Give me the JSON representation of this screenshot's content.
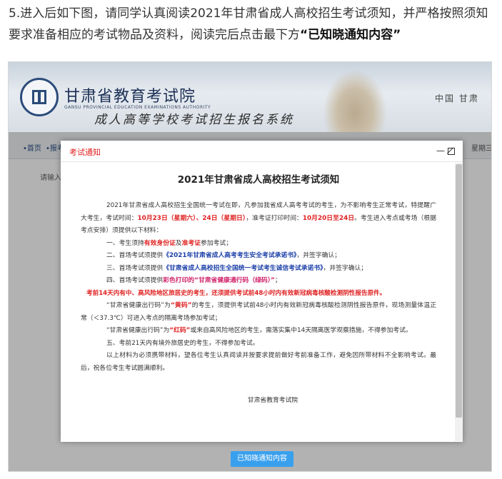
{
  "intro": {
    "text": "5.进入后如下图，请同学认真阅读2021年甘肃省成人高校招生考试须知，并严格按照须知要求准备相应的考试物品及资料，阅读完后点击最下方",
    "bold": "“已知晓通知内容”"
  },
  "header": {
    "org_cn": "甘肃省教育考试院",
    "org_en": "GANSU PROVINCIAL EDUCATION EXAMINATIONS AUTHORITY",
    "system": "成人高等学校考试招生报名系统",
    "region": "中国 甘肃"
  },
  "nav": {
    "home": "•首页",
    "signup": "•报考",
    "right": "星期三"
  },
  "page": {
    "hint": "请输入"
  },
  "modal": {
    "header_title": "考试通知",
    "doc_title": "2021年甘肃省成人高校招生考试须知",
    "p1_a": "2021年甘肃省成人高校招生全国统一考试在即，凡参加我省成人高考考试的考生，为不影响考生正常考试，特提醒广大考生，考试时间：",
    "p1_date1": "10月23日（星期六）、24日（星期日）",
    "p1_b": "，准考证打印时间：",
    "p1_date2": "10月20日至24日",
    "p1_c": "。考生进入考点或考场（根据考点安排）须提供以下材料：",
    "item1_a": "一、考生须持",
    "item1_b": "有效身份证",
    "item1_c": "及",
    "item1_d": "准考证",
    "item1_e": "参加考试；",
    "item2_a": "二、首场考试须提供",
    "item2_b": "《2021年甘肃省成人高考考生安全考试承诺书》",
    "item2_c": "，并签字确认；",
    "item3_a": "三、首场考试须提供",
    "item3_b": "《甘肃省成人高校招生全国统一考试考生诚信考试承诺书》",
    "item3_c": "，并签字确认；",
    "item4_a": "四、首场考试须提供",
    "item4_b": "彩色打印的“甘肃省健康通行码（绿码）”",
    "item4_c": "；",
    "warning": "考前14天内有中、高风险地区旅居史的考生，还须提供考试前48小时内有效新冠病毒核酸检测阴性报告原件。",
    "yellow_a": "“甘肃省健康出行码”为",
    "yellow_b": "“黄码”",
    "yellow_c": "的考生，须提供考试前48小时内有效新冠病毒核酸检测阴性报告原件，现场测量体温正常（＜37.3℃）可进入考点的隔离考场参加考试；",
    "red_a": "“甘肃省健康出行码”为",
    "red_b": "“红码”",
    "red_c": "或来自高风险地区的考生，需落实集中14天隔离医学观察措施，不得参加考试。",
    "item5": "五、考前21天内有境外旅居史的考生，不得参加考试。",
    "closing": "以上材料为必须携带材料，望各位考生认真阅读并按要求提前做好考前准备工作，避免因所带材料不全影响考试。最后，祝各位考生考试圆满顺利。",
    "signature": "甘肃省教育考试院"
  },
  "ack_button": "已知晓通知内容"
}
